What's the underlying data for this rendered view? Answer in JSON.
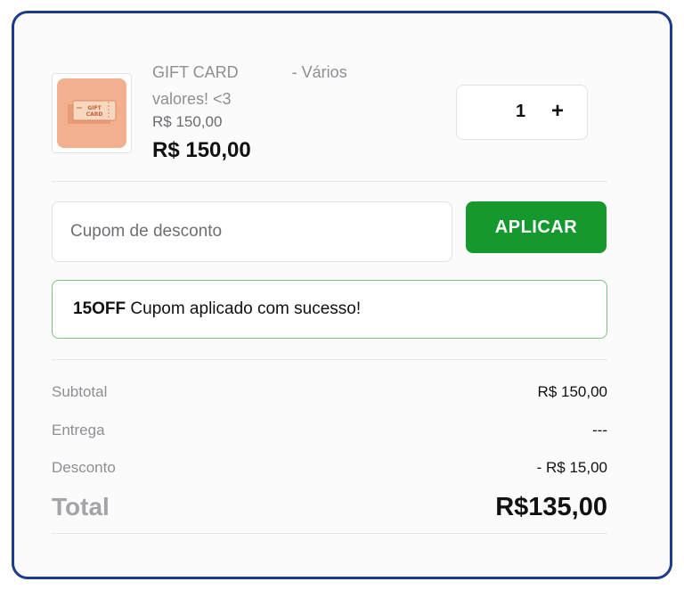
{
  "product": {
    "name": "GIFT CARD",
    "name_suffix": "- Vários",
    "name_line2": "valores! <3",
    "unit_price": "R$ 150,00",
    "line_price": "R$ 150,00",
    "quantity": "1",
    "plus_label": "+",
    "image_icon": "gift-card-icon"
  },
  "coupon": {
    "placeholder": "Cupom de desconto",
    "apply_label": "APLICAR",
    "code": "15OFF",
    "success_message": "Cupom aplicado com sucesso!"
  },
  "summary": {
    "subtotal_label": "Subtotal",
    "subtotal_value": "R$ 150,00",
    "delivery_label": "Entrega",
    "delivery_value": "---",
    "discount_label": "Desconto",
    "discount_value": "- R$ 15,00",
    "total_label": "Total",
    "total_value": "R$135,00"
  },
  "colors": {
    "frame_border": "#1d3a8a",
    "apply_button": "#15992e",
    "success_border": "#7fbf7f",
    "thumbnail_bg": "#f3b08f"
  }
}
